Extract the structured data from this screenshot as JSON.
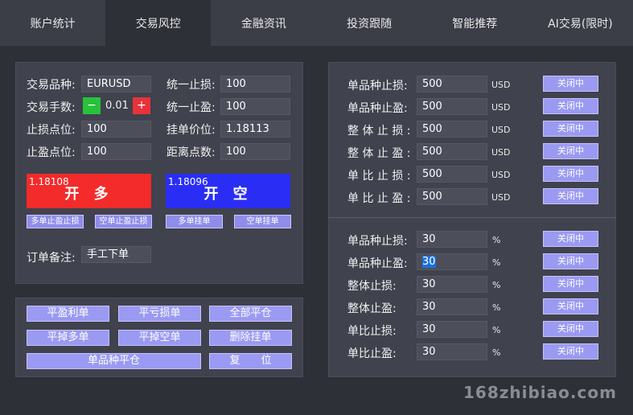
{
  "tabs": [
    {
      "label": "账户统计"
    },
    {
      "label": "交易风控"
    },
    {
      "label": "金融资讯"
    },
    {
      "label": "投资跟随"
    },
    {
      "label": "智能推荐"
    },
    {
      "label": "AI交易(限时)"
    }
  ],
  "trade": {
    "symbol_label": "交易品种:",
    "symbol_value": "EURUSD",
    "lots_label": "交易手数:",
    "lots_minus": "−",
    "lots_value": "0.01",
    "lots_plus": "+",
    "sl_label": "止损点位:",
    "sl_value": "100",
    "tp_label": "止盈点位:",
    "tp_value": "100",
    "unified_sl_label": "统一止损:",
    "unified_sl_value": "100",
    "unified_tp_label": "统一止盈:",
    "unified_tp_value": "100",
    "pending_price_label": "挂单价位:",
    "pending_price_value": "1.18113",
    "distance_label": "距离点数:",
    "distance_value": "100",
    "buy_price": "1.18108",
    "buy_label": "开 多",
    "sell_price": "1.18096",
    "sell_label": "开 空",
    "small_buttons": [
      "多单止盈止损",
      "空单止盈止损",
      "多单挂单",
      "空单挂单"
    ],
    "note_label": "订单备注:",
    "note_value": "手工下单"
  },
  "actions": {
    "close_profit": "平盈利单",
    "close_loss": "平亏损单",
    "close_all": "全部平仓",
    "close_long": "平掉多单",
    "close_short": "平掉空单",
    "delete_pending": "删除挂单",
    "close_symbol": "单品种平仓",
    "reset": "复　　位"
  },
  "risk_usd": {
    "rows": [
      {
        "label": "单品种止损:",
        "value": "500",
        "unit": "USD",
        "status": "关闭中"
      },
      {
        "label": "单品种止盈:",
        "value": "500",
        "unit": "USD",
        "status": "关闭中"
      },
      {
        "label": "整 体 止 损 :",
        "value": "500",
        "unit": "USD",
        "status": "关闭中"
      },
      {
        "label": "整 体 止 盈 :",
        "value": "500",
        "unit": "USD",
        "status": "关闭中"
      },
      {
        "label": "单 比 止 损 :",
        "value": "500",
        "unit": "USD",
        "status": "关闭中"
      },
      {
        "label": "单 比 止 盈 :",
        "value": "500",
        "unit": "USD",
        "status": "关闭中"
      }
    ]
  },
  "risk_pct": {
    "rows": [
      {
        "label": "单品种止损:",
        "value": "30",
        "unit": "%",
        "status": "关闭中"
      },
      {
        "label": "单品种止盈:",
        "value": "30",
        "unit": "%",
        "status": "关闭中"
      },
      {
        "label": "整体止损:",
        "value": "30",
        "unit": "%",
        "status": "关闭中"
      },
      {
        "label": "整体止盈:",
        "value": "30",
        "unit": "%",
        "status": "关闭中"
      },
      {
        "label": "单比止损:",
        "value": "30",
        "unit": "%",
        "status": "关闭中"
      },
      {
        "label": "单比止盈:",
        "value": "30",
        "unit": "%",
        "status": "关闭中"
      }
    ]
  },
  "watermark": "168zhibiao.com",
  "colors": {
    "buy": "#f32b2b",
    "sell": "#2a2ef5",
    "minus": "#27c23a",
    "plus": "#e8323a",
    "button": "#9b9af2"
  }
}
